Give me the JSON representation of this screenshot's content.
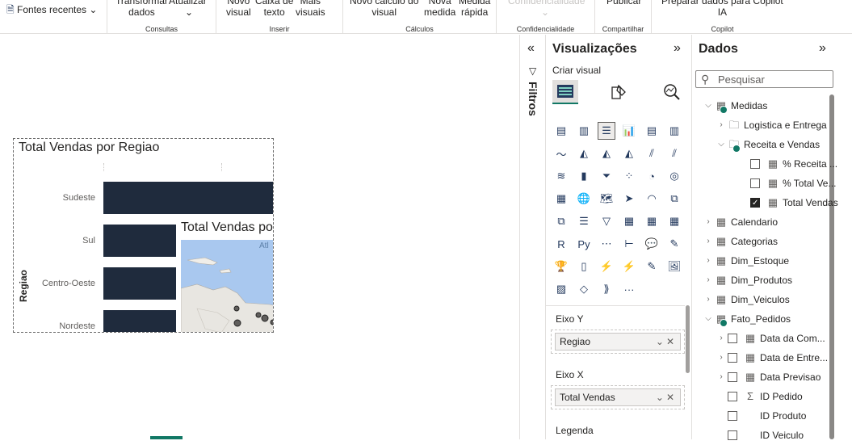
{
  "ribbon": {
    "fontes_recentes": "Fontes recentes",
    "transformar": "Transformar\ndados",
    "atualizar": "Atualizar",
    "group_consultas": "Consultas",
    "novo_visual": "Novo\nvisual",
    "caixa_texto": "Caixa de\ntexto",
    "mais_visuais": "Mais\nvisuais",
    "group_inserir": "Inserir",
    "novo_calculo": "Novo cálculo do\nvisual",
    "nova_medida": "Nova\nmedida",
    "medida_rapida": "Medida\nrápida",
    "group_calculos": "Cálculos",
    "confidencialidade_btn": "Confidencialidade",
    "group_confidencialidade": "Confidencialidade",
    "publicar": "Publicar",
    "group_compartilhar": "Compartilhar",
    "copilot_btn": "Preparar dados para Copilot\nIA",
    "group_copilot": "Copilot"
  },
  "canvas": {
    "visual_title": "Total Vendas por Regiao",
    "y_axis_label": "Regiao",
    "categories": [
      "Sudeste",
      "Sul",
      "Centro-Oeste",
      "Nordeste"
    ],
    "map_title": "Total Vendas po",
    "map_label": "Atl"
  },
  "filters": {
    "label": "Filtros"
  },
  "viz": {
    "title": "Visualizações",
    "criar_visual": "Criar visual",
    "more": "···",
    "eixo_y": "Eixo Y",
    "eixo_y_field": "Regiao",
    "eixo_x": "Eixo X",
    "eixo_x_field": "Total Vendas",
    "legenda": "Legenda",
    "icons": [
      "stacked-bar-chart-icon",
      "stacked-column-chart-icon",
      "clustered-bar-chart-icon",
      "clustered-column-chart-icon",
      "100pct-stacked-bar-icon",
      "100pct-stacked-column-icon",
      "line-chart-icon",
      "area-chart-icon",
      "stacked-area-chart-icon",
      "100pct-stacked-area-icon",
      "line-clustered-column-icon",
      "line-stacked-column-icon",
      "ribbon-chart-icon",
      "waterfall-chart-icon",
      "funnel-chart-icon",
      "scatter-chart-icon",
      "pie-chart-icon",
      "donut-chart-icon",
      "treemap-icon",
      "map-icon",
      "filled-map-icon",
      "azure-map-icon",
      "gauge-icon",
      "card-icon",
      "multi-row-card-icon",
      "kpi-icon",
      "slicer-icon",
      "table-icon",
      "matrix-icon",
      "matrix-alt-icon",
      "r-visual-icon",
      "python-visual-icon",
      "key-influencers-icon",
      "decomposition-tree-icon",
      "qa-icon",
      "smart-narrative-icon",
      "goals-icon",
      "paginated-report-icon",
      "power-apps-icon",
      "power-automate-icon",
      "narrative-icon",
      "image-visual-icon",
      "build-visual-icon",
      "shape-icon",
      "arrow-icon"
    ]
  },
  "data": {
    "title": "Dados",
    "search_placeholder": "Pesquisar",
    "tree": [
      {
        "label": "Medidas"
      },
      {
        "label": "Logistica e Entrega"
      },
      {
        "label": "Receita e Vendas"
      },
      {
        "label": "% Receita ..."
      },
      {
        "label": "% Total Ve..."
      },
      {
        "label": "Total Vendas"
      },
      {
        "label": "Calendario"
      },
      {
        "label": "Categorias"
      },
      {
        "label": "Dim_Estoque"
      },
      {
        "label": "Dim_Produtos"
      },
      {
        "label": "Dim_Veiculos"
      },
      {
        "label": "Fato_Pedidos"
      },
      {
        "label": "Data da Com..."
      },
      {
        "label": "Data de Entre..."
      },
      {
        "label": "Data Previsao"
      },
      {
        "label": "ID Pedido"
      },
      {
        "label": "ID Produto"
      },
      {
        "label": "ID Veiculo"
      }
    ]
  }
}
